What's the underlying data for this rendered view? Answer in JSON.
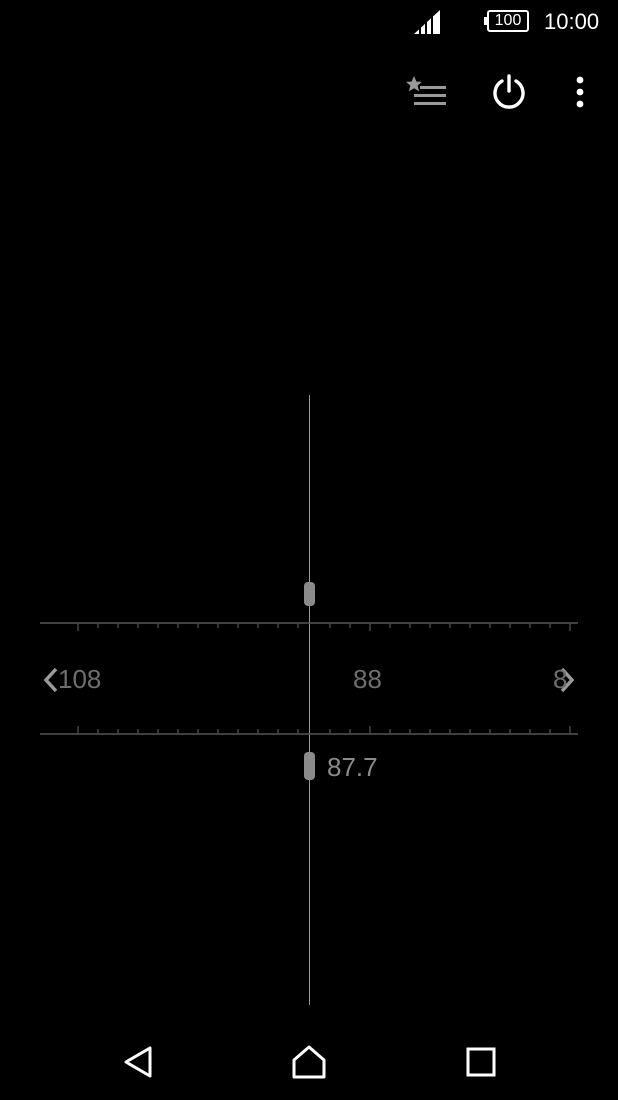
{
  "status_bar": {
    "battery_level": "100",
    "time": "10:00",
    "icons": [
      "signal-icon",
      "battery-icon"
    ]
  },
  "action_bar": {
    "icons": [
      "favorites-list-icon",
      "power-icon",
      "more-vert-icon"
    ]
  },
  "tuner": {
    "scale_labels": [
      "108",
      "88",
      "8"
    ],
    "current_frequency": "87.7",
    "icons": [
      "chevron-left-icon",
      "chevron-right-icon"
    ],
    "colors": {
      "scale_text": "#6e6e6e",
      "frequency_text": "#8a8a8a",
      "needle": "#9a9a9a"
    }
  },
  "nav_bar": {
    "icons": [
      "back-icon",
      "home-icon",
      "recents-icon"
    ]
  }
}
